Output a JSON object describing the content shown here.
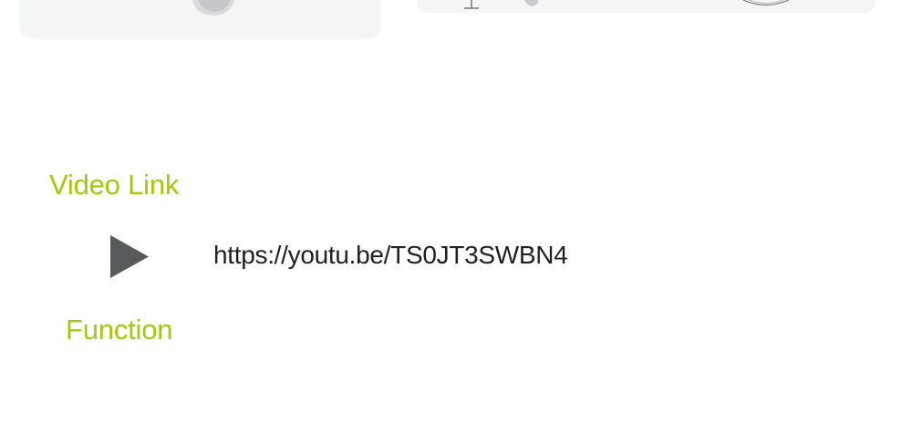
{
  "colors": {
    "accent": "#a4c80c",
    "text": "#231f20",
    "card_bg": "#f4f5f5",
    "icon": "#58595b"
  },
  "video_section": {
    "heading": "Video Link",
    "play_icon": "play-icon",
    "url": "https://youtu.be/TS0JT3SWBN4"
  },
  "function_section": {
    "heading": "Function"
  }
}
